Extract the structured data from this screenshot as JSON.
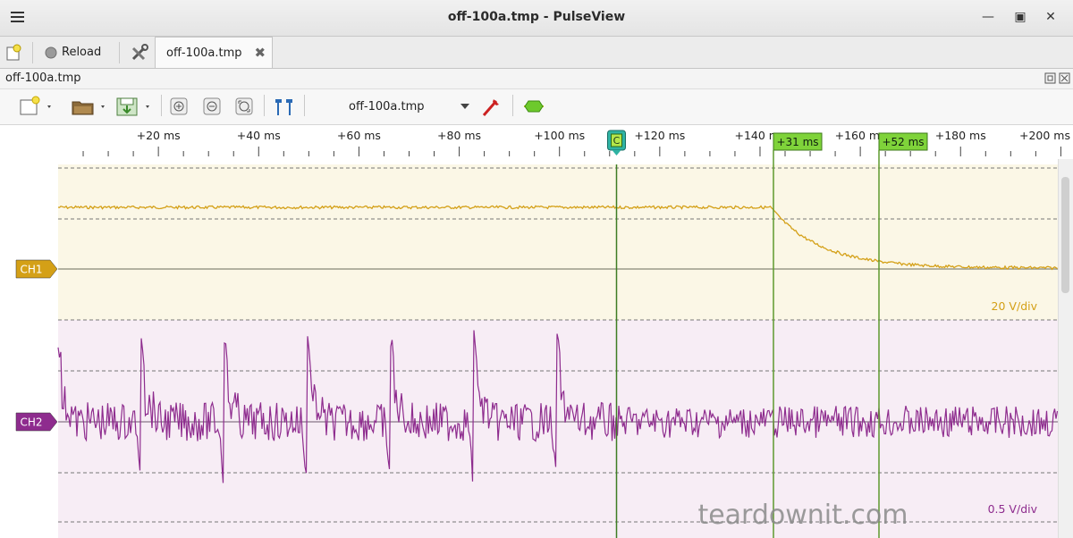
{
  "window": {
    "title": "off-100a.tmp - PulseView"
  },
  "tabbar": {
    "reload_label": "Reload",
    "tab_label": "off-100a.tmp"
  },
  "document": {
    "name": "off-100a.tmp"
  },
  "toolbar": {
    "device_combo": "off-100a.tmp"
  },
  "ruler": {
    "ticks": [
      "+20 ms",
      "+40 ms",
      "+60 ms",
      "+80 ms",
      "+100 ms",
      "+120 ms",
      "+140 ms",
      "+160 ms",
      "+180 ms",
      "+200 ms"
    ],
    "cursor_label": "C",
    "marker1_label": "+31 ms",
    "marker2_label": "+52 ms"
  },
  "channels": [
    {
      "name": "CH1",
      "scale": "20 V/div",
      "color": "#d4a017",
      "bg": "#fbf7e6"
    },
    {
      "name": "CH2",
      "scale": "0.5 V/div",
      "color": "#8e2c8e",
      "bg": "#f7edf5"
    }
  ],
  "watermark": "teardownit.com",
  "colors": {
    "marker": "#5e9a2e",
    "marker_label_bg": "#7fd33a",
    "cursor_bg": "#2fb3a3"
  }
}
